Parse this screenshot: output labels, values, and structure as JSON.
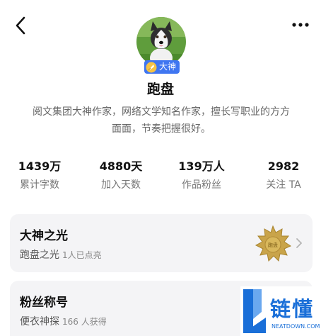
{
  "header": {
    "back_icon": "chevron-left-icon",
    "more_icon": "more-horizontal-icon"
  },
  "profile": {
    "badge_label": "大神",
    "name": "跑盘",
    "intro_line1": "阅文集团大神作家，网络文学知名作家，擅长写职业的方方",
    "intro_line2": "面面，节奏把握很好。"
  },
  "stats": [
    {
      "value": "1439万",
      "label": "累计字数"
    },
    {
      "value": "4880天",
      "label": "加入天数"
    },
    {
      "value": "139万人",
      "label": "作品粉丝"
    },
    {
      "value": "2982",
      "label": "关注 TA"
    }
  ],
  "cards": {
    "glory": {
      "title": "大神之光",
      "subtitle": "跑盘之光",
      "count": "1人已点亮",
      "medal_text": "跑盘"
    },
    "fans": {
      "title": "粉丝称号",
      "subtitle": "便衣神探",
      "count": "166 人获得"
    }
  },
  "watermark": {
    "cn": "链懂",
    "en": "NEATDOWN.COM"
  },
  "colors": {
    "badge": "#3f76f1",
    "card_bg": "#f4f4f6",
    "medal": "#c9a44a",
    "watermark": "#1a6fd8"
  }
}
